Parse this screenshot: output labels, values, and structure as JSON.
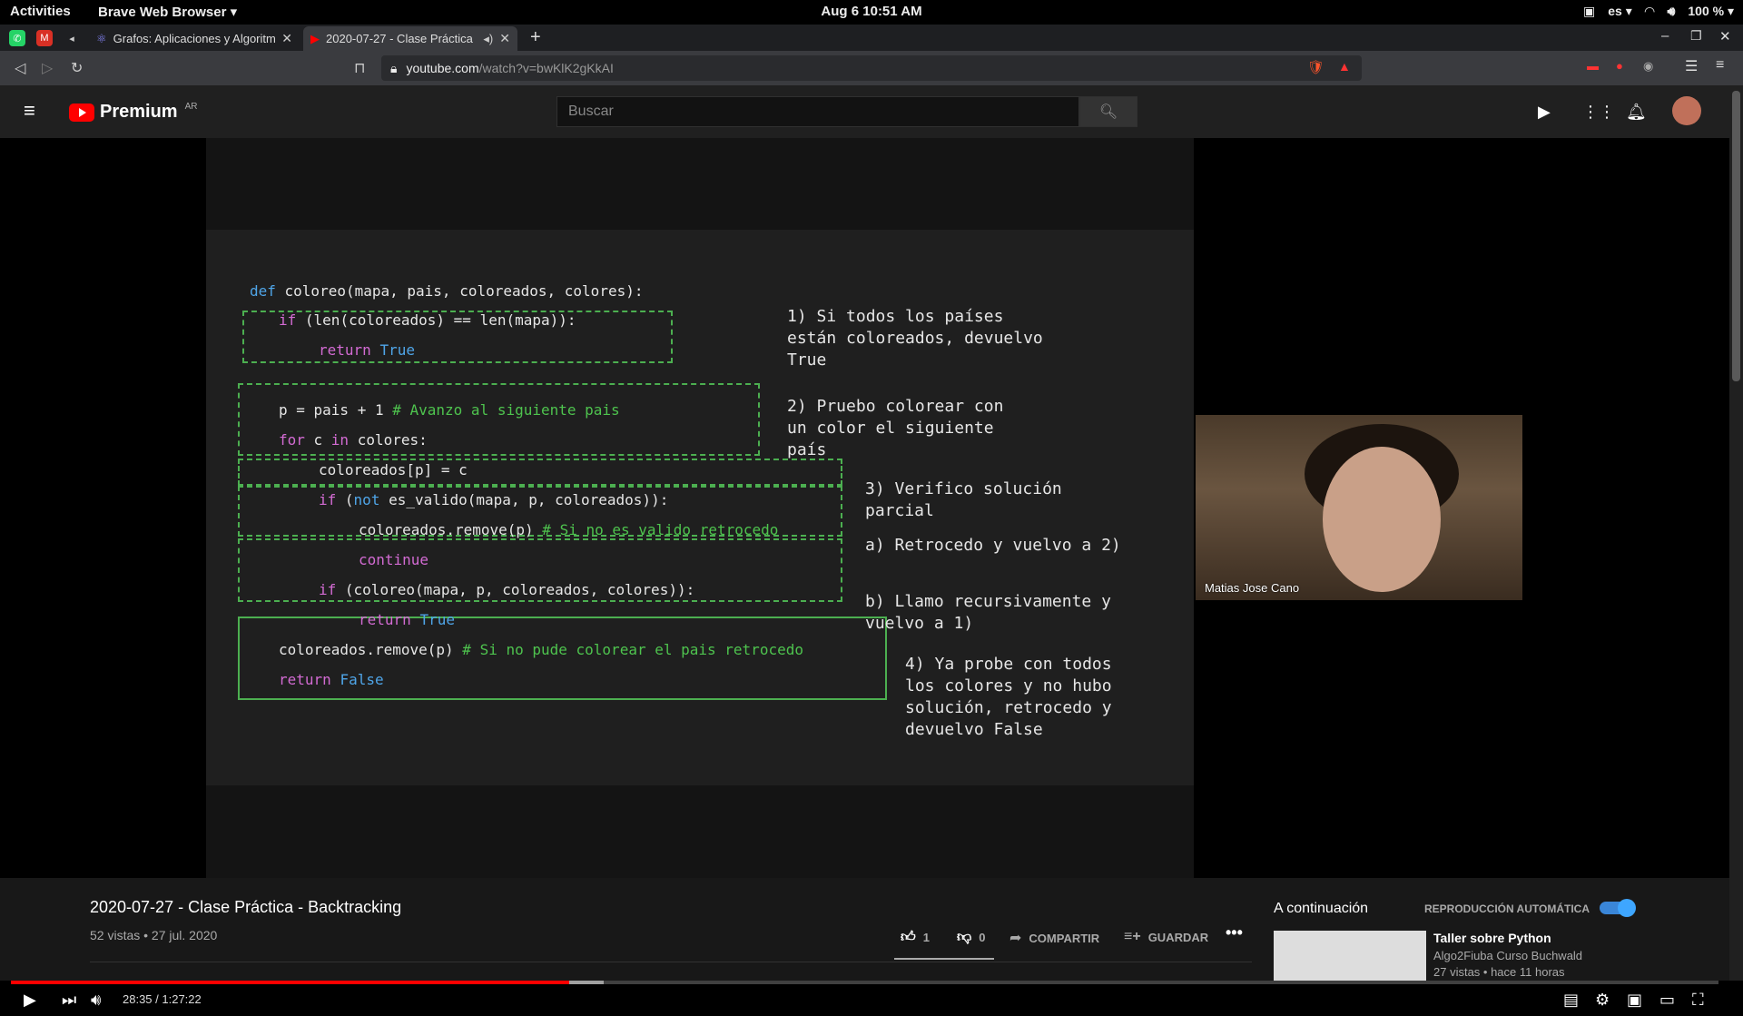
{
  "system": {
    "activities": "Activities",
    "app_name": "Brave Web Browser ▾",
    "clock": "Aug 6  10:51 AM",
    "lang": "es ▾",
    "battery": "100 % ▾"
  },
  "tabs": [
    {
      "title": "Grafos: Aplicaciones y Algoritm"
    },
    {
      "title": "2020-07-27 - Clase Práctica -"
    }
  ],
  "address": {
    "domain": "youtube.com",
    "path": "/watch?v=bwKlK2gKkAI"
  },
  "yt": {
    "logo": "Premium",
    "region": "AR",
    "search_placeholder": "Buscar"
  },
  "slide": {
    "code_lines": [
      {
        "pre": "def ",
        "pre_cls": "kwb",
        "text": "coloreo(mapa, pais, coloreados, colores):"
      },
      {
        "pre": "if ",
        "pre_cls": "kw",
        "text": "(len(coloreados) == len(mapa)):"
      },
      {
        "pre": "return ",
        "pre_cls": "kw",
        "text": "",
        "post": "True",
        "post_cls": "kwb"
      },
      {
        "pre": "",
        "text": "p = pais + 1 ",
        "post": "# Avanzo al siguiente pais",
        "post_cls": "cm"
      },
      {
        "pre": "for ",
        "pre_cls": "kw",
        "text": "c ",
        "mid": "in ",
        "mid_cls": "kw",
        "post": "colores:"
      },
      {
        "pre": "",
        "text": "coloreados[p] = c"
      },
      {
        "pre": "if ",
        "pre_cls": "kw",
        "text": "(",
        "mid": "not ",
        "mid_cls": "kwb",
        "post": "es_valido(mapa, p, coloreados)):"
      },
      {
        "pre": "",
        "text": "coloreados.remove(p) ",
        "post": "# Si no es valido retrocedo",
        "post_cls": "cm"
      },
      {
        "pre": "continue",
        "pre_cls": "kw",
        "text": ""
      },
      {
        "pre": "if ",
        "pre_cls": "kw",
        "text": "(coloreo(mapa, p, coloreados, colores)):"
      },
      {
        "pre": "return ",
        "pre_cls": "kw",
        "text": "",
        "post": "True",
        "post_cls": "kwb"
      },
      {
        "pre": "",
        "text": "coloreados.remove(p) ",
        "post": "# Si no pude colorear el pais retrocedo",
        "post_cls": "cm"
      },
      {
        "pre": "return ",
        "pre_cls": "kw",
        "text": "",
        "post": "False",
        "post_cls": "kwb"
      }
    ],
    "notes": [
      "1) Si todos los países\nestán coloreados, devuelvo\nTrue",
      "2) Pruebo colorear con\nun color el siguiente\npaís",
      "3) Verifico solución\nparcial",
      "a) Retrocedo y vuelvo a 2)",
      "b) Llamo recursivamente y\nvuelvo a 1)",
      "4) Ya probe con todos\nlos colores y no hubo\nsolución, retrocedo y\ndevuelvo False"
    ]
  },
  "webcam": {
    "name": "Matias Jose Cano"
  },
  "player": {
    "time": "28:35 / 1:27:22",
    "progress_fraction": 0.327
  },
  "video": {
    "title": "2020-07-27 - Clase Práctica - Backtracking",
    "meta": "52 vistas • 27 jul. 2020",
    "likes": "1",
    "dislikes": "0",
    "share": "COMPARTIR",
    "save": "GUARDAR"
  },
  "sidebar": {
    "up_next": "A continuación",
    "autoplay": "REPRODUCCIÓN AUTOMÁTICA",
    "next_title": "Taller sobre Python",
    "next_channel": "Algo2Fiuba Curso Buchwald",
    "next_meta": "27 vistas • hace 11 horas"
  }
}
